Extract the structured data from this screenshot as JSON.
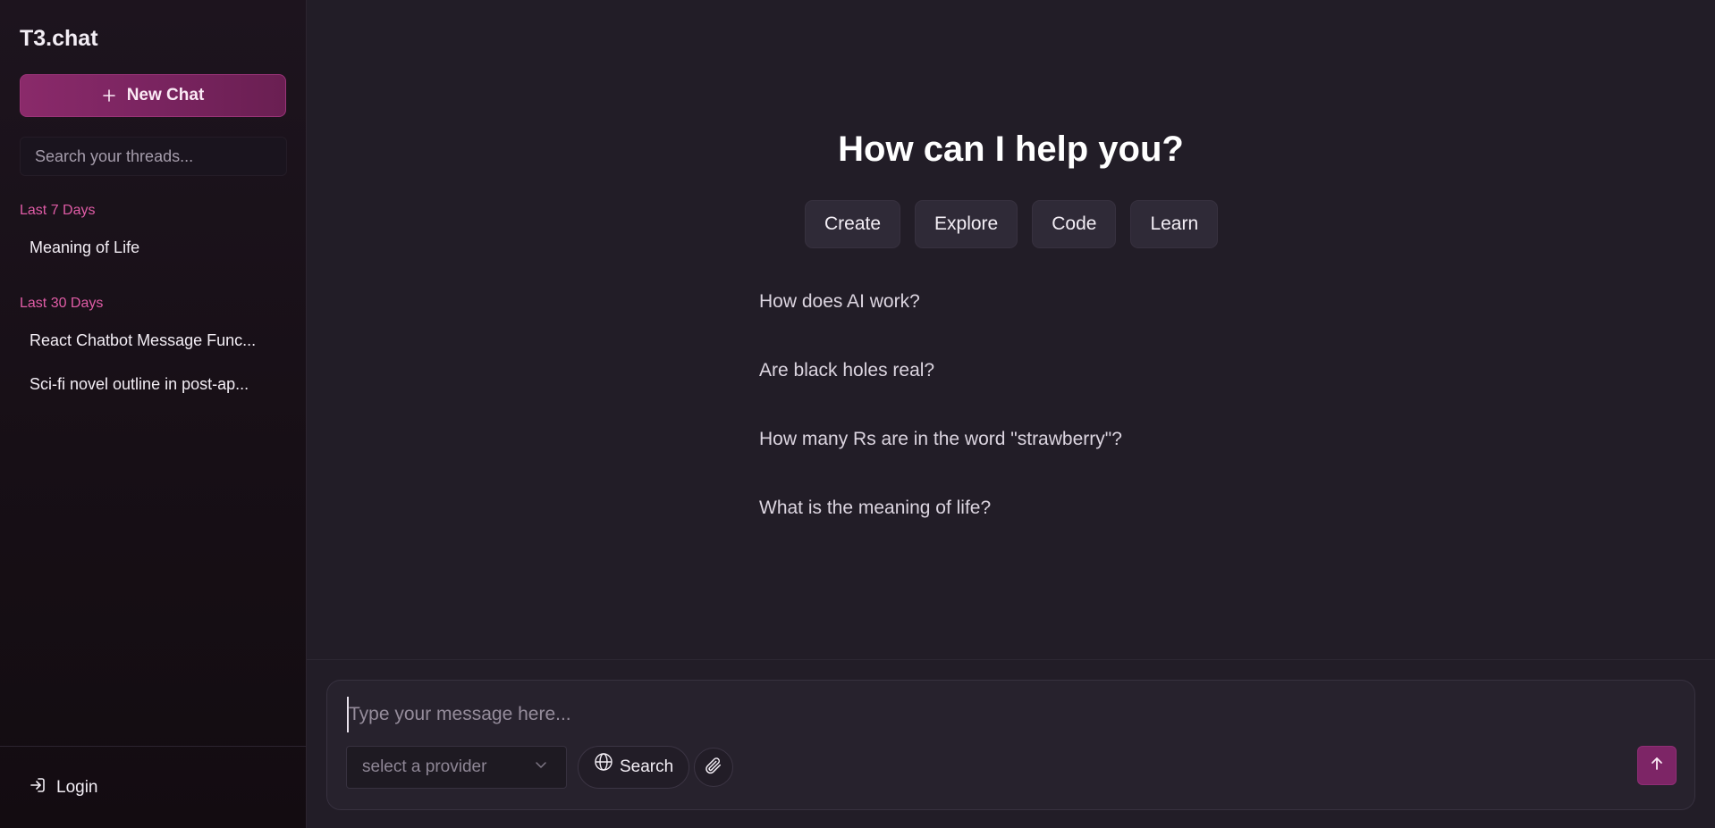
{
  "brand": "T3.chat",
  "sidebar": {
    "new_chat_label": "New Chat",
    "search_placeholder": "Search your threads...",
    "groups": [
      {
        "label": "Last 7 Days",
        "threads": [
          "Meaning of Life"
        ]
      },
      {
        "label": "Last 30 Days",
        "threads": [
          "React Chatbot Message Func...",
          "Sci-fi novel outline in post-ap..."
        ]
      }
    ],
    "login_label": "Login"
  },
  "main": {
    "heading": "How can I help you?",
    "categories": [
      "Create",
      "Explore",
      "Code",
      "Learn"
    ],
    "suggestions": [
      "How does AI work?",
      "Are black holes real?",
      "How many Rs are in the word \"strawberry\"?",
      "What is the meaning of life?"
    ]
  },
  "composer": {
    "placeholder": "Type your message here...",
    "provider_placeholder": "select a provider",
    "search_label": "Search"
  },
  "icons": {
    "new_chat": "plus-icon",
    "login": "login-icon",
    "provider": "chevron-down-icon",
    "search": "globe-icon",
    "attach": "paperclip-icon",
    "send": "arrow-up-icon"
  },
  "colors": {
    "accent": "#7d2566",
    "group_label": "#e05ca6",
    "background": "#221d27",
    "sidebar": "#170f16"
  }
}
